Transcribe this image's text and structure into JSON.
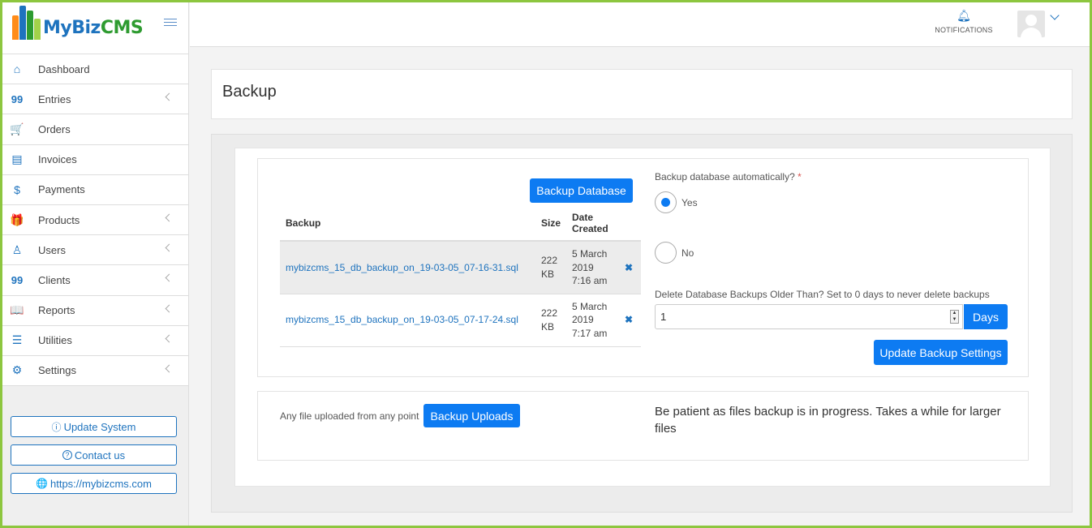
{
  "brand": {
    "logo_part1": "MyBiz",
    "logo_part2": "CMS",
    "bar_colors": [
      "#ff8c1a",
      "#1e73be",
      "#2e9b30",
      "#a3d24a"
    ]
  },
  "sidebar": {
    "items": [
      {
        "label": "Dashboard",
        "icon": "home-icon",
        "glyph": "⌂",
        "submenu": false
      },
      {
        "label": "Entries",
        "icon": "quote-icon",
        "glyph": "99",
        "submenu": true
      },
      {
        "label": "Orders",
        "icon": "cart-icon",
        "glyph": "🛒",
        "submenu": false
      },
      {
        "label": "Invoices",
        "icon": "invoice-icon",
        "glyph": "▤",
        "submenu": false
      },
      {
        "label": "Payments",
        "icon": "dollar-icon",
        "glyph": "$",
        "submenu": false
      },
      {
        "label": "Products",
        "icon": "gift-icon",
        "glyph": "🎁",
        "submenu": true
      },
      {
        "label": "Users",
        "icon": "user-icon",
        "glyph": "♙",
        "submenu": true
      },
      {
        "label": "Clients",
        "icon": "quote-icon",
        "glyph": "99",
        "submenu": true
      },
      {
        "label": "Reports",
        "icon": "book-icon",
        "glyph": "📖",
        "submenu": true
      },
      {
        "label": "Utilities",
        "icon": "list-icon",
        "glyph": "☰",
        "submenu": true
      },
      {
        "label": "Settings",
        "icon": "gear-icon",
        "glyph": "⚙",
        "submenu": true
      }
    ],
    "buttons": {
      "update": {
        "label": "Update System",
        "icon": "info-icon",
        "glyph": "ⓘ"
      },
      "contact": {
        "label": "Contact us",
        "icon": "question-icon",
        "glyph": "?"
      },
      "website": {
        "label": "https://mybizcms.com",
        "icon": "globe-icon",
        "glyph": "🌐"
      }
    }
  },
  "header": {
    "notifications_label": "NOTIFICATIONS",
    "bell_icon": "bell-icon"
  },
  "page": {
    "title": "Backup"
  },
  "backup": {
    "button_label": "Backup Database",
    "columns": {
      "name": "Backup",
      "size": "Size",
      "date": "Date Created"
    },
    "rows": [
      {
        "file": "mybizcms_15_db_backup_on_19-03-05_07-16-31.sql",
        "size": "222 KB",
        "date": "5 March 2019 7:16 am",
        "delete": "✖"
      },
      {
        "file": "mybizcms_15_db_backup_on_19-03-05_07-17-24.sql",
        "size": "222 KB",
        "date": "5 March 2019 7:17 am",
        "delete": "✖"
      }
    ]
  },
  "settings": {
    "auto_question": "Backup database automatically?",
    "required_mark": "*",
    "yes_label": "Yes",
    "no_label": "No",
    "selected": "Yes",
    "delete_label": "Delete Database Backups Older Than? Set to 0 days to never delete backups",
    "days_value": "1",
    "days_label": "Days",
    "update_button": "Update Backup Settings"
  },
  "uploads": {
    "label": "Any file uploaded from any point",
    "button_label": "Backup Uploads",
    "notice": "Be patient as files backup is in progress. Takes a while for larger files"
  },
  "colors": {
    "accent": "#0d7bf2",
    "link": "#1e73be",
    "frame": "#8dc63f"
  }
}
